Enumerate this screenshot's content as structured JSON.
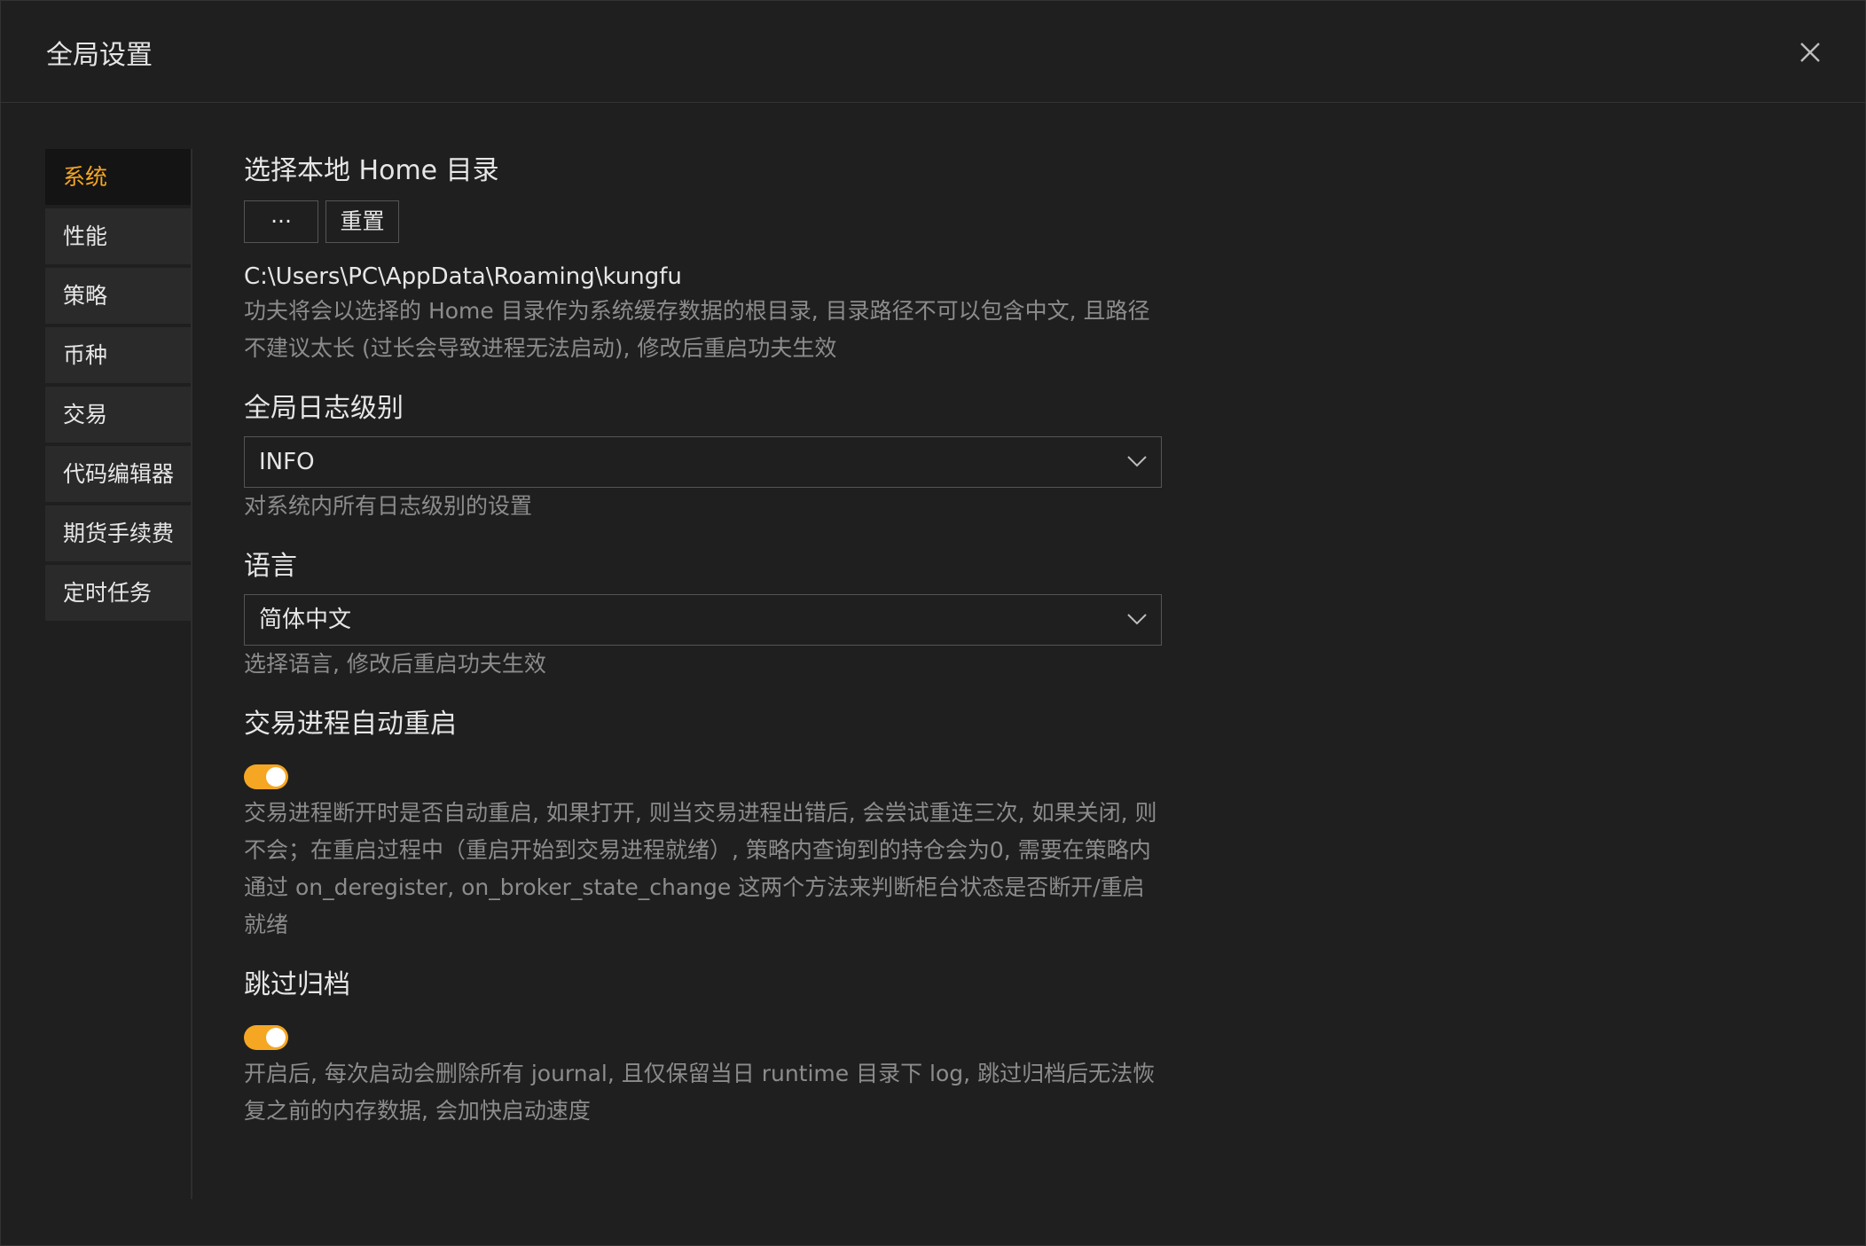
{
  "modal": {
    "title": "全局设置"
  },
  "sidebar": {
    "items": [
      {
        "label": "系统",
        "active": true
      },
      {
        "label": "性能"
      },
      {
        "label": "策略"
      },
      {
        "label": "币种"
      },
      {
        "label": "交易"
      },
      {
        "label": "代码编辑器"
      },
      {
        "label": "期货手续费"
      },
      {
        "label": "定时任务"
      }
    ]
  },
  "home": {
    "title": "选择本地 Home 目录",
    "browse_label": "···",
    "reset_label": "重置",
    "path": "C:\\Users\\PC\\AppData\\Roaming\\kungfu",
    "description": "功夫将会以选择的 Home 目录作为系统缓存数据的根目录, 目录路径不可以包含中文, 且路径不建议太长 (过长会导致进程无法启动), 修改后重启功夫生效"
  },
  "log_level": {
    "title": "全局日志级别",
    "value": "INFO",
    "description": "对系统内所有日志级别的设置"
  },
  "language": {
    "title": "语言",
    "value": "简体中文",
    "description": "选择语言, 修改后重启功夫生效"
  },
  "auto_restart": {
    "title": "交易进程自动重启",
    "enabled": true,
    "description": "交易进程断开时是否自动重启, 如果打开, 则当交易进程出错后, 会尝试重连三次, 如果关闭, 则不会；在重启过程中（重启开始到交易进程就绪）, 策略内查询到的持仓会为0, 需要在策略内通过 on_deregister, on_broker_state_change 这两个方法来判断柜台状态是否断开/重启就绪"
  },
  "skip_archive": {
    "title": "跳过归档",
    "enabled": true,
    "description": "开启后, 每次启动会删除所有 journal, 且仅保留当日 runtime 目录下 log, 跳过归档后无法恢复之前的内存数据, 会加快启动速度"
  },
  "colors": {
    "accent": "#f5a623",
    "background": "#1f1f1f",
    "muted_text": "#8c8c8c"
  }
}
